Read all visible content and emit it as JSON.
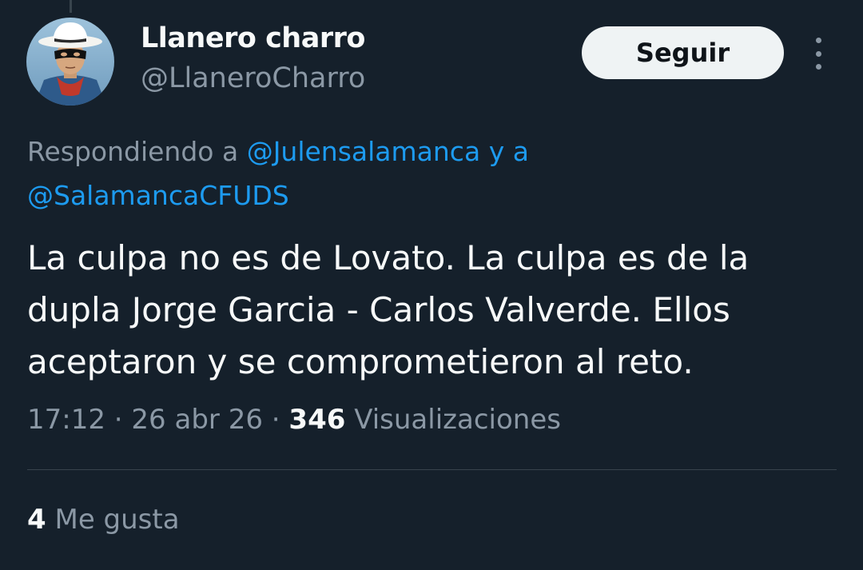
{
  "user": {
    "display_name": "Llanero charro",
    "handle": "@LlaneroCharro",
    "avatar_icon": "masked-cowboy-avatar"
  },
  "actions": {
    "follow_label": "Seguir",
    "more_icon": "more-vertical-icon"
  },
  "reply_context": {
    "prefix": "Respondiendo a",
    "mention_1": "@Julensalamanca",
    "joiner": "y a",
    "mention_2": "@SalamancaCFUDS"
  },
  "tweet": {
    "text": "La culpa no es de Lovato. La culpa es de la dupla Jorge Garcia - Carlos Valverde. Ellos aceptaron y se comprometieron al reto."
  },
  "meta": {
    "time": "17:12",
    "separator": "·",
    "date": "26 abr 26",
    "views_count": "346",
    "views_label": "Visualizaciones"
  },
  "engagement": {
    "likes_count": "4",
    "likes_label": "Me gusta"
  },
  "colors": {
    "background": "#15202b",
    "text_primary": "#f7f9f9",
    "text_secondary": "#8b98a5",
    "link": "#1d9bf0",
    "button_bg": "#eff3f4",
    "divider": "#38444d"
  }
}
